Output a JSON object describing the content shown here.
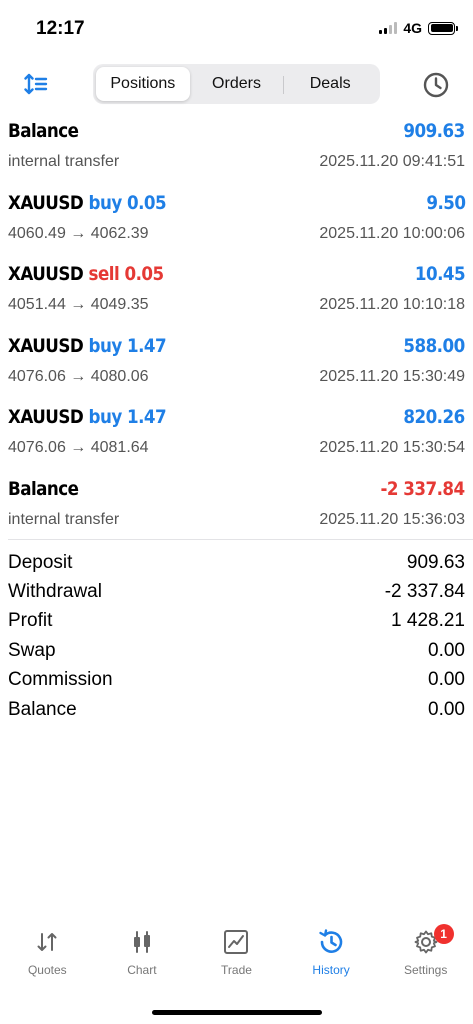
{
  "status_bar": {
    "time": "12:17",
    "network": "4G"
  },
  "toolbar": {
    "segments": [
      {
        "label": "Positions",
        "active": true
      },
      {
        "label": "Orders",
        "active": false
      },
      {
        "label": "Deals",
        "active": false
      }
    ]
  },
  "deals": [
    {
      "symbol": "Balance",
      "type": "",
      "volume": "",
      "amount": "909.63",
      "amount_sign": "pos",
      "detail": "internal transfer",
      "time": "2025.11.20 09:41:51"
    },
    {
      "symbol": "XAUUSD",
      "type": "buy",
      "volume": "0.05",
      "amount": "9.50",
      "amount_sign": "pos",
      "detail": "4060.49 → 4062.39",
      "time": "2025.11.20 10:00:06"
    },
    {
      "symbol": "XAUUSD",
      "type": "sell",
      "volume": "0.05",
      "amount": "10.45",
      "amount_sign": "pos",
      "detail": "4051.44 → 4049.35",
      "time": "2025.11.20 10:10:18"
    },
    {
      "symbol": "XAUUSD",
      "type": "buy",
      "volume": "1.47",
      "amount": "588.00",
      "amount_sign": "pos",
      "detail": "4076.06 → 4080.06",
      "time": "2025.11.20 15:30:49"
    },
    {
      "symbol": "XAUUSD",
      "type": "buy",
      "volume": "1.47",
      "amount": "820.26",
      "amount_sign": "pos",
      "detail": "4076.06 → 4081.64",
      "time": "2025.11.20 15:30:54"
    },
    {
      "symbol": "Balance",
      "type": "",
      "volume": "",
      "amount": "-2 337.84",
      "amount_sign": "neg",
      "detail": "internal transfer",
      "time": "2025.11.20 15:36:03"
    }
  ],
  "summary": [
    {
      "label": "Deposit",
      "value": "909.63"
    },
    {
      "label": "Withdrawal",
      "value": "-2 337.84"
    },
    {
      "label": "Profit",
      "value": "1 428.21"
    },
    {
      "label": "Swap",
      "value": "0.00"
    },
    {
      "label": "Commission",
      "value": "0.00"
    },
    {
      "label": "Balance",
      "value": "0.00"
    }
  ],
  "tabbar": {
    "tabs": [
      {
        "label": "Quotes",
        "icon": "quotes-arrows-icon",
        "active": false
      },
      {
        "label": "Chart",
        "icon": "candlestick-chart-icon",
        "active": false
      },
      {
        "label": "Trade",
        "icon": "trade-chart-icon",
        "active": false
      },
      {
        "label": "History",
        "icon": "history-clock-icon",
        "active": true
      },
      {
        "label": "Settings",
        "icon": "gear-icon",
        "active": false,
        "badge": "1"
      }
    ]
  },
  "colors": {
    "accent": "#1f7fe6",
    "negative": "#e53935",
    "badge": "#f0312e"
  }
}
